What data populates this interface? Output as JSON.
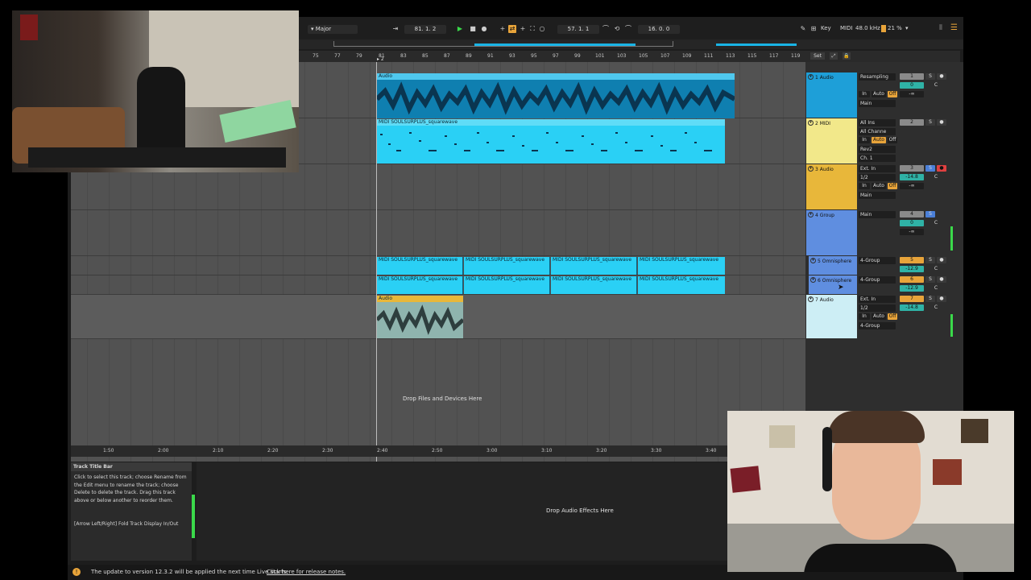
{
  "transport": {
    "scale": "Major",
    "arrangement_position": "81. 1. 2",
    "loop_start": "57. 1. 1",
    "loop_length": "16. 0. 0",
    "key_label": "Key",
    "midi_label": "MIDI",
    "sample_rate": "48.0 kHz",
    "cpu": "21 %"
  },
  "ruler": {
    "bars": [
      "75",
      "77",
      "79",
      "81",
      "83",
      "85",
      "87",
      "89",
      "91",
      "93",
      "95",
      "97",
      "99",
      "101",
      "103",
      "105",
      "107",
      "109",
      "111",
      "113",
      "115",
      "117",
      "119"
    ],
    "marker": "2",
    "set_label": "Set"
  },
  "tracks": [
    {
      "number": "1",
      "name": "1 Audio",
      "color": "#1e9fd8",
      "input": "Resampling",
      "output": "Main",
      "monitor_off": "Off",
      "in": "In",
      "auto": "Auto",
      "volume": "0",
      "pan": "C",
      "inf": "-∞"
    },
    {
      "number": "2",
      "name": "2 MIDI",
      "color": "#f2e88a",
      "input": "All Ins",
      "channel": "All Channe",
      "monitor_auto": "Auto",
      "in": "In",
      "off": "Off",
      "output": "Rev2",
      "ch": "Ch. 1"
    },
    {
      "number": "3",
      "name": "3 Audio",
      "color": "#e8b73a",
      "input": "Ext. In",
      "sub": "1/2",
      "in": "In",
      "auto": "Auto",
      "monitor_off": "Off",
      "output": "Main",
      "volume": "-14.8",
      "pan": "C",
      "inf": "-∞"
    },
    {
      "number": "4",
      "name": "4 Group",
      "color": "#5f8ee0",
      "output": "Main",
      "volume": "0",
      "pan": "C",
      "inf": "-∞"
    },
    {
      "number": "5",
      "name": "5 Omnisphere",
      "color": "#5f8ee0",
      "output": "4-Group",
      "volume": "-12.9",
      "pan": "C"
    },
    {
      "number": "6",
      "name": "6 Omnisphere",
      "color": "#5f8ee0",
      "output": "4-Group",
      "volume": "-12.9",
      "pan": "C"
    },
    {
      "number": "7",
      "name": "7 Audio",
      "color": "#cdeef5",
      "input": "Ext. In",
      "sub": "1/2",
      "in": "In",
      "auto": "Auto",
      "monitor_off": "Off",
      "output": "4-Group",
      "volume": "-14.8",
      "pan": "C"
    }
  ],
  "clips": {
    "audio1": "Audio",
    "midi2": "MIDI SOULSURPLUS_squarewave",
    "omni_clip": "MIDI SOULSURPLUS_squarewave",
    "audio7": "Audio"
  },
  "drop_hint": "Drop Files and Devices Here",
  "time_ruler": [
    "1:50",
    "2:00",
    "2:10",
    "2:20",
    "2:30",
    "2:40",
    "2:50",
    "3:00",
    "3:10",
    "3:20",
    "3:30",
    "3:40"
  ],
  "info": {
    "title": "Track Title Bar",
    "body": "Click to select this track; choose Rename from the Edit menu to rename the track; choose Delete to delete the track. Drag this track above or below another to reorder them.",
    "shortcut": "[Arrow Left/Right] Fold Track Display In/Out"
  },
  "device_hint": "Drop Audio Effects Here",
  "status": {
    "message": "The update to version 12.3.2 will be applied the next time Live starts.",
    "link": "Click here for release notes."
  },
  "icons": [
    "play-icon",
    "stop-icon",
    "record-icon",
    "info-icon",
    "fold-icon"
  ],
  "colors": {
    "clip_blue": "#19b4e6",
    "clip_yellow": "#e8b73a",
    "play_green": "#3ad94a",
    "record_red": "#e04040"
  }
}
